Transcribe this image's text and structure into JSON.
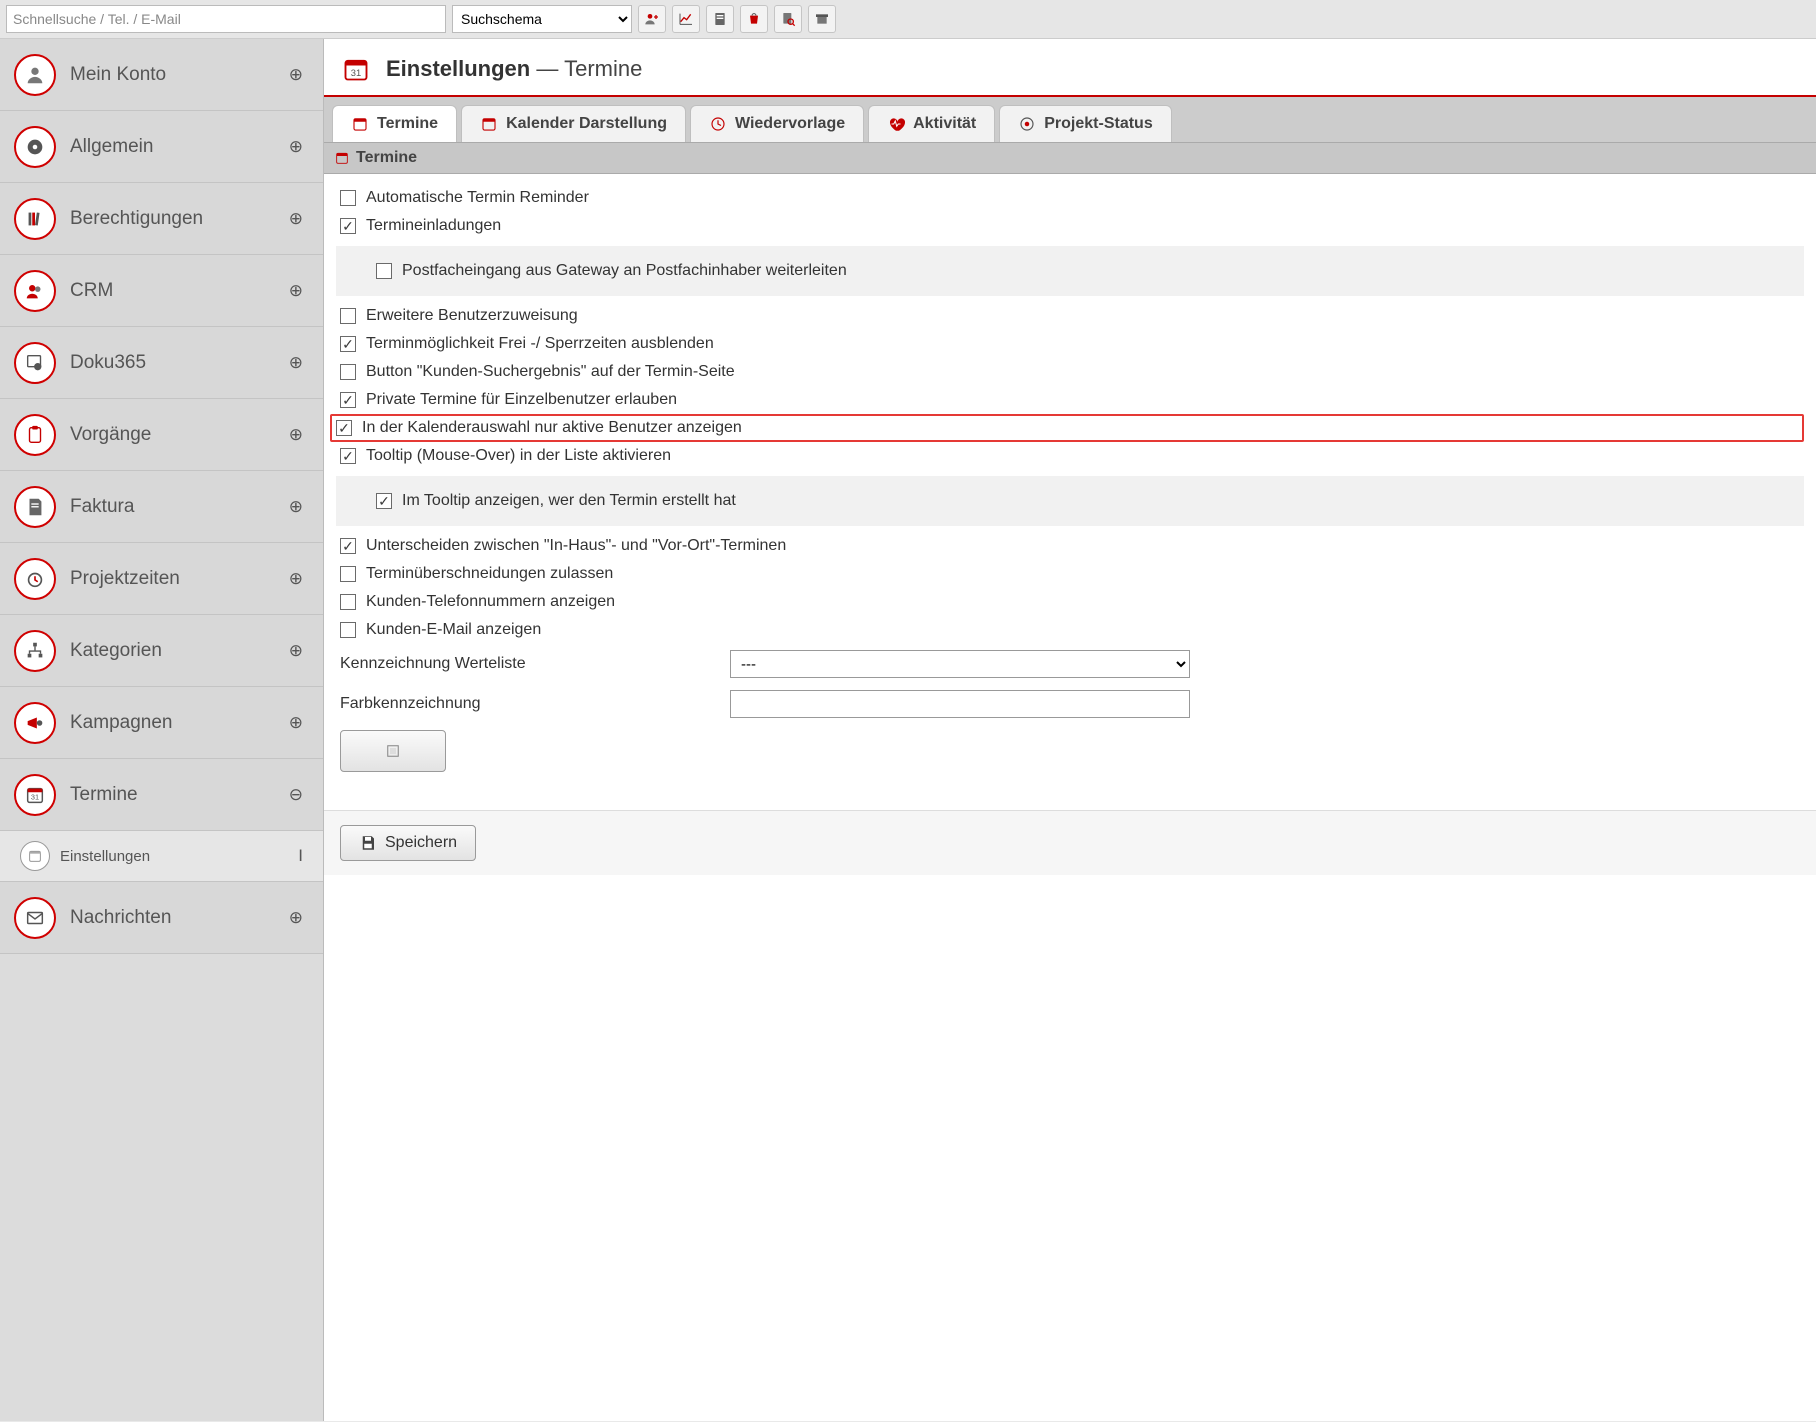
{
  "topbar": {
    "search_placeholder": "Schnellsuche / Tel. / E-Mail",
    "schema_label": "Suchschema",
    "icon_buttons": [
      "person-add",
      "chart-line",
      "doc",
      "cart",
      "doc-zoom",
      "archive"
    ]
  },
  "sidebar": {
    "items": [
      {
        "label": "Mein Konto",
        "toggle": "⊕",
        "iconColor": "#cf0000"
      },
      {
        "label": "Allgemein",
        "toggle": "⊕",
        "iconColor": "#cf0000"
      },
      {
        "label": "Berechtigungen",
        "toggle": "⊕",
        "iconColor": "#cf0000"
      },
      {
        "label": "CRM",
        "toggle": "⊕",
        "iconColor": "#cf0000"
      },
      {
        "label": "Doku365",
        "toggle": "⊕",
        "iconColor": "#cf0000"
      },
      {
        "label": "Vorgänge",
        "toggle": "⊕",
        "iconColor": "#cf0000"
      },
      {
        "label": "Faktura",
        "toggle": "⊕",
        "iconColor": "#cf0000"
      },
      {
        "label": "Projektzeiten",
        "toggle": "⊕",
        "iconColor": "#cf0000"
      },
      {
        "label": "Kategorien",
        "toggle": "⊕",
        "iconColor": "#cf0000"
      },
      {
        "label": "Kampagnen",
        "toggle": "⊕",
        "iconColor": "#cf0000"
      },
      {
        "label": "Termine",
        "toggle": "⊖",
        "iconColor": "#cf0000"
      },
      {
        "label": "Einstellungen",
        "toggle": "I",
        "sub": true
      },
      {
        "label": "Nachrichten",
        "toggle": "⊕",
        "iconColor": "#cf0000"
      }
    ]
  },
  "page": {
    "title_strong": "Einstellungen",
    "title_sep": " — ",
    "title_rest": "Termine"
  },
  "tabs": [
    {
      "label": "Termine",
      "active": true
    },
    {
      "label": "Kalender Darstellung"
    },
    {
      "label": "Wiedervorlage"
    },
    {
      "label": "Aktivität"
    },
    {
      "label": "Projekt-Status"
    }
  ],
  "section": {
    "header": "Termine"
  },
  "options": {
    "auto_reminder": {
      "label": "Automatische Termin Reminder",
      "checked": false
    },
    "invites": {
      "label": "Termineinladungen",
      "checked": true
    },
    "gateway_forward": {
      "label": "Postfacheingang aus Gateway an Postfachinhaber weiterleiten",
      "checked": false
    },
    "ext_user_assign": {
      "label": "Erweitere Benutzerzuweisung",
      "checked": false
    },
    "hide_free_block": {
      "label": "Terminmöglichkeit Frei -/ Sperrzeiten ausblenden",
      "checked": true
    },
    "btn_customer_search": {
      "label": "Button \"Kunden-Suchergebnis\" auf der Termin-Seite",
      "checked": false
    },
    "private_single": {
      "label": "Private Termine für Einzelbenutzer erlauben",
      "checked": true
    },
    "only_active_users": {
      "label": "In der Kalenderauswahl nur aktive Benutzer anzeigen",
      "checked": true,
      "highlight": true
    },
    "tooltip_list": {
      "label": "Tooltip (Mouse-Over) in der Liste aktivieren",
      "checked": true
    },
    "tooltip_creator": {
      "label": "Im Tooltip anzeigen, wer den Termin erstellt hat",
      "checked": true
    },
    "distinguish_inhouse": {
      "label": "Unterscheiden zwischen \"In-Haus\"- und \"Vor-Ort\"-Terminen",
      "checked": true
    },
    "allow_overlap": {
      "label": "Terminüberschneidungen zulassen",
      "checked": false
    },
    "cust_phone": {
      "label": "Kunden-Telefonnummern anzeigen",
      "checked": false
    },
    "cust_email": {
      "label": "Kunden-E-Mail anzeigen",
      "checked": false
    }
  },
  "kv": {
    "value_list_label": "Kennzeichnung Werteliste",
    "value_list_value": "---",
    "color_label": "Farbkennzeichnung",
    "color_value": ""
  },
  "footer": {
    "save": "Speichern"
  }
}
